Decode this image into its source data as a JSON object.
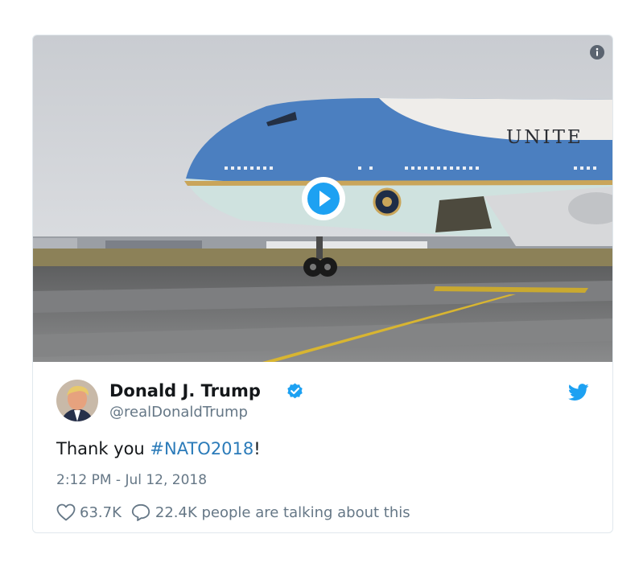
{
  "media": {
    "plane_text": "UNITE",
    "play_icon": "play-icon",
    "info_icon": "info-icon"
  },
  "tweet": {
    "author_name": "Donald J. Trump",
    "author_handle": "@realDonaldTrump",
    "text_before": "Thank you ",
    "hashtag": "#NATO2018",
    "text_after": "!",
    "timestamp": "2:12 PM - Jul 12, 2018",
    "likes": "63.7K",
    "talking": "22.4K people are talking about this"
  },
  "colors": {
    "link": "#2b7bb9",
    "verified": "#1da1f2",
    "twitter_blue": "#1da1f2",
    "secondary_text": "#657786"
  }
}
